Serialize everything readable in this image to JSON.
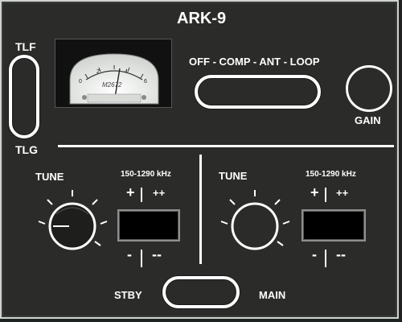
{
  "title": "ARK-9",
  "left_switch": {
    "top_label": "TLF",
    "bottom_label": "TLG"
  },
  "meter": {
    "label": "M2672",
    "scale": [
      "0",
      "2",
      "4",
      "6"
    ]
  },
  "mode_selector": {
    "label": "OFF - COMP - ANT - LOOP"
  },
  "gain": {
    "label": "GAIN"
  },
  "tuner_left": {
    "tune_label": "TUNE",
    "range_label": "150-1290 kHz",
    "plus_label": "+",
    "plusplus_label": "++",
    "minus_label": "-",
    "minusminus_label": "--"
  },
  "tuner_right": {
    "tune_label": "TUNE",
    "range_label": "150-1290 kHz",
    "plus_label": "+",
    "plusplus_label": "++",
    "minus_label": "-",
    "minusminus_label": "--"
  },
  "standby_switch": {
    "left_label": "STBY",
    "right_label": "MAIN"
  },
  "colors": {
    "panel": "#2b2c2a",
    "text": "#ffffff",
    "meter_face": "#e9ebe6",
    "display": "#000000"
  },
  "icons": {
    "tune_knob": "tune-knob-icon",
    "needle": "meter-needle-icon"
  }
}
